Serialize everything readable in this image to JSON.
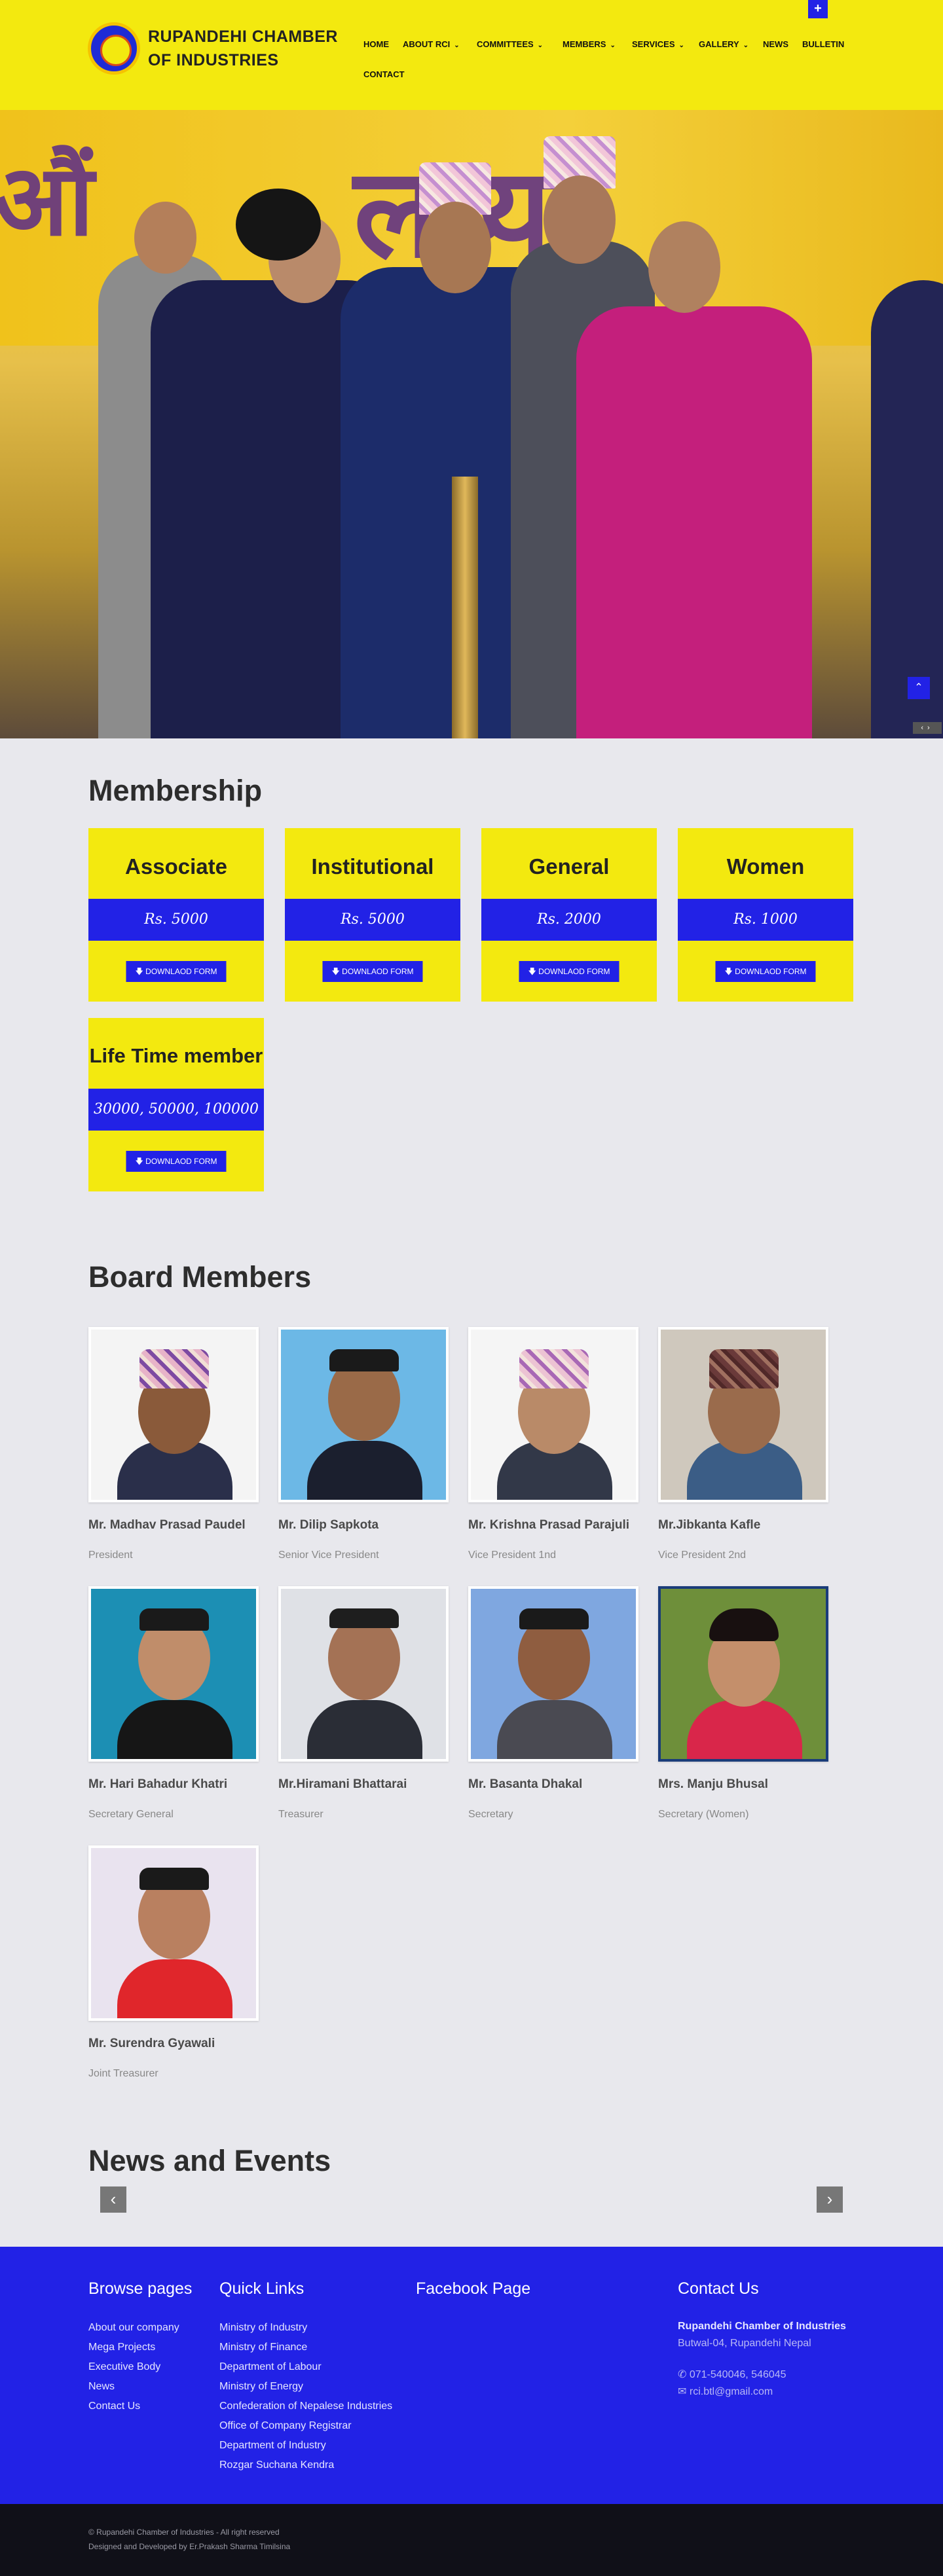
{
  "header": {
    "brand_line1": "RUPANDEHI CHAMBER",
    "brand_line2": "OF INDUSTRIES",
    "nav": [
      {
        "label": "HOME",
        "dropdown": false
      },
      {
        "label": "ABOUT RCI",
        "dropdown": true
      },
      {
        "label": "COMMITTEES",
        "dropdown": true
      },
      {
        "label": "MEMBERS",
        "dropdown": true
      },
      {
        "label": "SERVICES",
        "dropdown": true
      },
      {
        "label": "GALLERY",
        "dropdown": true
      },
      {
        "label": "NEWS",
        "dropdown": false
      },
      {
        "label": "BULLETIN",
        "dropdown": false
      },
      {
        "label": "CONTACT",
        "dropdown": false
      }
    ],
    "plus_label": "+"
  },
  "colors": {
    "accent_yellow": "#f3e90f",
    "accent_blue": "#2222e6",
    "background": "#e8e8ed",
    "footer_dark": "#101018"
  },
  "membership": {
    "title": "Membership",
    "download_label": "DOWNLAOD FORM",
    "cards": [
      {
        "name": "Associate",
        "price": "Rs. 5000"
      },
      {
        "name": "Institutional",
        "price": "Rs. 5000"
      },
      {
        "name": "General",
        "price": "Rs. 2000"
      },
      {
        "name": "Women",
        "price": "Rs. 1000"
      },
      {
        "name": "Life Time member",
        "price": "30000, 50000, 100000"
      }
    ]
  },
  "board": {
    "title": "Board Members",
    "members": [
      {
        "name": "Mr. Madhav Prasad Paudel",
        "role": "President"
      },
      {
        "name": "Mr. Dilip Sapkota",
        "role": "Senior Vice President"
      },
      {
        "name": "Mr. Krishna Prasad Parajuli",
        "role": "Vice President 1nd"
      },
      {
        "name": "Mr.Jibkanta Kafle",
        "role": "Vice President 2nd"
      },
      {
        "name": "Mr. Hari Bahadur Khatri",
        "role": "Secretary General"
      },
      {
        "name": "Mr.Hiramani Bhattarai",
        "role": "Treasurer"
      },
      {
        "name": "Mr. Basanta Dhakal",
        "role": "Secretary"
      },
      {
        "name": "Mrs. Manju Bhusal",
        "role": "Secretary (Women)"
      },
      {
        "name": "Mr. Surendra Gyawali",
        "role": "Joint Treasurer"
      }
    ]
  },
  "news": {
    "title": "News and Events",
    "prev": "‹",
    "next": "›"
  },
  "footer": {
    "browse": {
      "title": "Browse pages",
      "links": [
        "About our company",
        "Mega Projects",
        "Executive Body",
        "News",
        "Contact Us"
      ]
    },
    "quick": {
      "title": "Quick Links",
      "links": [
        "Ministry of Industry",
        "Ministry of Finance",
        "Department of Labour",
        "Ministry of Energy",
        "Confederation of Nepalese Industries",
        "Office of Company Registrar",
        "Department of Industry",
        "Rozgar Suchana Kendra"
      ]
    },
    "facebook": {
      "title": "Facebook Page"
    },
    "contact": {
      "title": "Contact Us",
      "org": "Rupandehi Chamber of Industries",
      "address": "Butwal-04, Rupandehi Nepal",
      "phone": "071-540046, 546045",
      "email": "rci.btl@gmail.com"
    }
  },
  "copyright": {
    "line1": "© Rupandehi Chamber of Industries - All right reserved",
    "line2": "Designed and Developed by Er.Prakash Sharma Timilsina"
  }
}
